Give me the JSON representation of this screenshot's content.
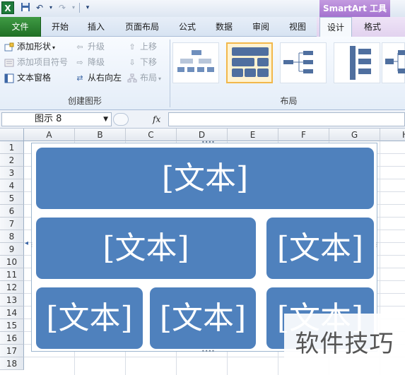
{
  "qat": {
    "logo_text": "X",
    "save_icon": "save-icon",
    "undo_icon": "undo-icon",
    "redo_icon": "redo-icon",
    "customize_icon": "customize-icon"
  },
  "context_header": "SmartArt 工具",
  "tabs": [
    "文件",
    "开始",
    "插入",
    "页面布局",
    "公式",
    "数据",
    "审阅",
    "视图",
    "设计",
    "格式"
  ],
  "active_tab": "设计",
  "ribbon": {
    "create_graphic": {
      "add_shape": "添加形状",
      "add_bullet": "添加项目符号",
      "text_pane": "文本窗格",
      "promote": "升级",
      "demote": "降级",
      "right_to_left": "从右向左",
      "move_up": "上移",
      "move_down": "下移",
      "layout": "布局",
      "label": "创建图形"
    },
    "layouts": {
      "label": "布局",
      "thumbnail_count": 5,
      "selected_index": 1
    }
  },
  "formula_bar": {
    "name_box": "图示  8",
    "fx_label": "fx",
    "formula": ""
  },
  "sheet": {
    "columns": [
      "A",
      "B",
      "C",
      "D",
      "E",
      "F",
      "G",
      "H"
    ],
    "rows": [
      "1",
      "2",
      "3",
      "4",
      "5",
      "6",
      "7",
      "8",
      "9",
      "10",
      "11",
      "12",
      "13",
      "14",
      "15",
      "16",
      "17",
      "18"
    ]
  },
  "smartart": {
    "placeholder": "[文本]",
    "color": "#4f81bd",
    "boxes": [
      "[文本]",
      "[文本]",
      "[文本]",
      "[文本]",
      "[文本]",
      "[文本]"
    ]
  },
  "watermark": "软件技巧"
}
